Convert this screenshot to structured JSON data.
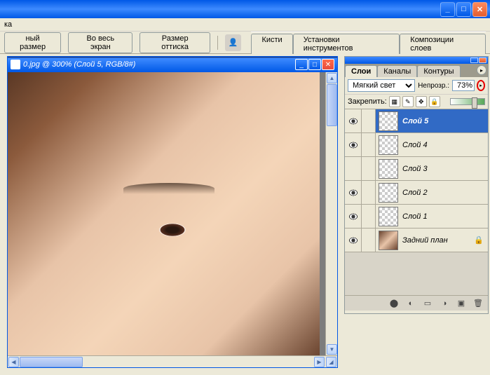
{
  "app": {
    "menu_fragment": "ка"
  },
  "toolbar": {
    "actual_size": "ный размер",
    "full_screen": "Во весь экран",
    "print_size": "Размер оттиска",
    "tabs": {
      "brushes": "Кисти",
      "tool_presets": "Установки инструментов",
      "layer_comps": "Композиции слоев"
    }
  },
  "document": {
    "title": "0.jpg @ 300% (Слой 5, RGB/8#)"
  },
  "layers_panel": {
    "tabs": {
      "layers": "Слои",
      "channels": "Каналы",
      "paths": "Контуры"
    },
    "blend_mode": "Мягкий свет",
    "opacity_label": "Непрозр.:",
    "opacity_value": "73%",
    "lock_label": "Закрепить:",
    "layers": [
      {
        "name": "Слой 5",
        "visible": true,
        "selected": true,
        "bg": false
      },
      {
        "name": "Слой 4",
        "visible": true,
        "selected": false,
        "bg": false
      },
      {
        "name": "Слой 3",
        "visible": false,
        "selected": false,
        "bg": false
      },
      {
        "name": "Слой 2",
        "visible": true,
        "selected": false,
        "bg": false
      },
      {
        "name": "Слой 1",
        "visible": true,
        "selected": false,
        "bg": false
      },
      {
        "name": "Задний план",
        "visible": true,
        "selected": false,
        "bg": true,
        "locked": true
      }
    ]
  },
  "colors": {
    "xp_blue": "#0058e6",
    "selection": "#316ac5",
    "highlight": "#e60000"
  }
}
